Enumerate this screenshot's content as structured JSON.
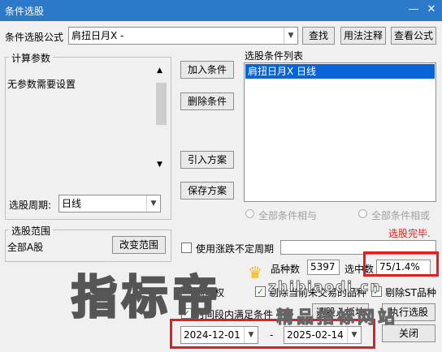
{
  "window": {
    "title": "条件选股",
    "minimize_icon": "minus-icon",
    "close_icon": "close-icon"
  },
  "formula": {
    "label": "条件选股公式",
    "value": "肩扭日月X  -",
    "buttons": [
      "查找",
      "用法注释",
      "查看公式"
    ]
  },
  "calc_params": {
    "title": "计算参数",
    "message": "无参数需要设置"
  },
  "actions": {
    "add": "加入条件",
    "delete": "删除条件",
    "import": "引入方案",
    "save": "保存方案"
  },
  "condition_list": {
    "title": "选股条件列表",
    "items": [
      "肩扭日月X  日线"
    ]
  },
  "period": {
    "label": "选股周期:",
    "value": "日线"
  },
  "logic": {
    "and_label": "全部条件相与",
    "or_label": "全部条件相或"
  },
  "status": {
    "text": "选股完毕.",
    "color": "#e02020"
  },
  "range": {
    "title": "选股范围",
    "value": "全部A股",
    "change_button": "改变范围"
  },
  "uncertain_period": {
    "label": "使用涨跌不定周期",
    "checked": false
  },
  "stats": {
    "count_label": "品种数",
    "count_value": "5397",
    "hit_label": "选中数",
    "hit_value": "75/1.4%"
  },
  "options": {
    "opt1": "前复权",
    "opt2": "剔除当前未交易的品种",
    "opt3": "剔除ST品种"
  },
  "time_range": {
    "label": "时间段内满足条件",
    "start": "2024-12-01",
    "separator": "-",
    "end": "2025-02-14"
  },
  "bottom_buttons": {
    "to_board": "选股入板块",
    "execute": "执行选股",
    "close": "关闭"
  },
  "watermark": {
    "big": "指标帝",
    "site": "zhibiaodi.cn",
    "slogan": "精品指标网站"
  }
}
